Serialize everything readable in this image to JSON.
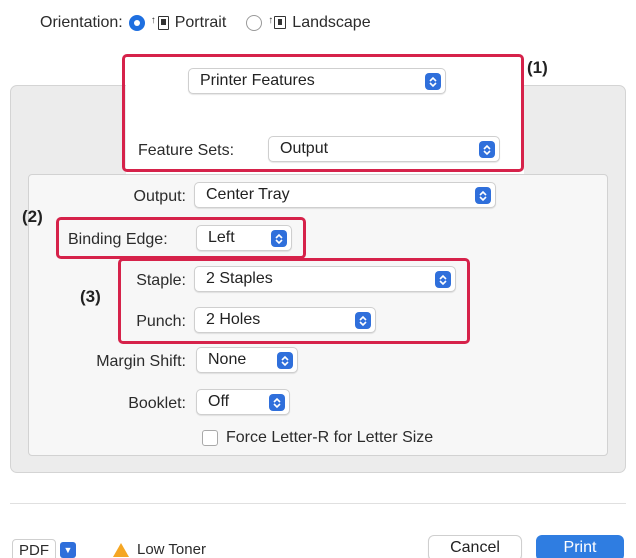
{
  "orientation": {
    "label": "Orientation:",
    "options": [
      {
        "label": "Portrait",
        "selected": true
      },
      {
        "label": "Landscape",
        "selected": false
      }
    ]
  },
  "panel_select": {
    "value": "Printer Features"
  },
  "feature_sets": {
    "label": "Feature Sets:",
    "value": "Output"
  },
  "fields": {
    "output": {
      "label": "Output:",
      "value": "Center Tray"
    },
    "binding_edge": {
      "label": "Binding Edge:",
      "value": "Left"
    },
    "staple": {
      "label": "Staple:",
      "value": "2 Staples"
    },
    "punch": {
      "label": "Punch:",
      "value": "2 Holes"
    },
    "margin_shift": {
      "label": "Margin Shift:",
      "value": "None"
    },
    "booklet": {
      "label": "Booklet:",
      "value": "Off"
    }
  },
  "checkbox": {
    "label": "Force Letter-R for Letter Size",
    "checked": false
  },
  "callouts": {
    "c1": "(1)",
    "c2": "(2)",
    "c3": "(3)"
  },
  "footer": {
    "pdf_label": "PDF",
    "warning_text": "Low Toner",
    "cancel_label": "Cancel",
    "print_label": "Print"
  },
  "colors": {
    "accent": "#2f6fdb",
    "highlight": "#d6224a",
    "warning": "#f5a623",
    "print_button": "#2f7de1"
  }
}
